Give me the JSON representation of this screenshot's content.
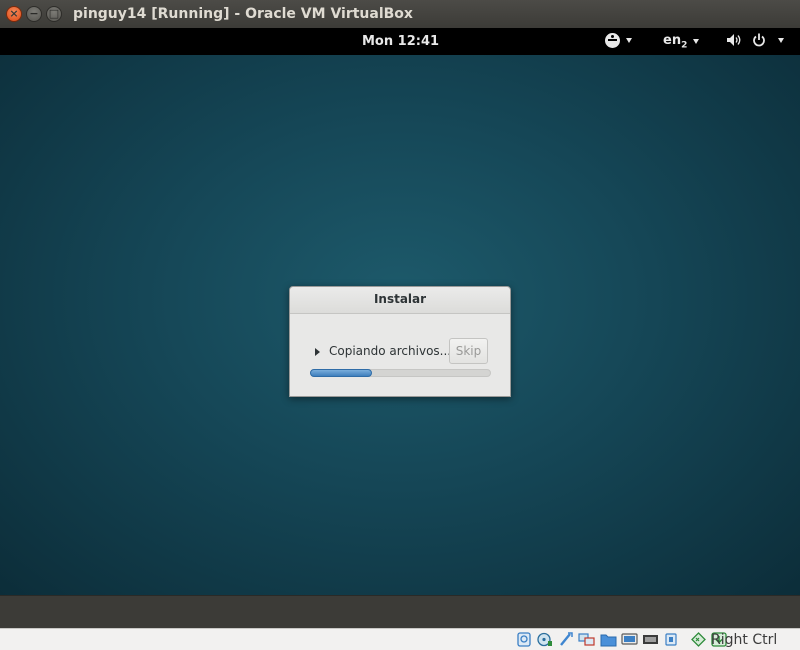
{
  "window": {
    "title": "pinguy14 [Running] - Oracle VM VirtualBox",
    "close_glyph": "×",
    "minimize_glyph": "−",
    "maximize_glyph": "□"
  },
  "guest_panel": {
    "clock": "Mon 12:41",
    "language": "en",
    "language_sub": "2",
    "icons": [
      "accessibility-icon",
      "volume-icon",
      "power-icon"
    ]
  },
  "dialog": {
    "title": "Instalar",
    "status": "Copiando archivos...",
    "skip_label": "Skip",
    "progress": 0.34
  },
  "statusbar": {
    "icons": [
      {
        "name": "hard-disk-icon",
        "color": "#3b7fc4"
      },
      {
        "name": "optical-drive-icon",
        "color": "#2a6e9c"
      },
      {
        "name": "usb-icon",
        "color": "#3f86d0"
      },
      {
        "name": "network-icon",
        "color": "#3b7fc4"
      },
      {
        "name": "shared-folders-icon",
        "color": "#3f86d0"
      },
      {
        "name": "display-icon",
        "color": "#5a5a5a"
      },
      {
        "name": "video-capture-icon",
        "color": "#3b3b3b"
      },
      {
        "name": "cpu-icon",
        "color": "#3b7fc4"
      },
      {
        "name": "mouse-integration-icon",
        "color": "#2e8b3a"
      },
      {
        "name": "keyboard-capture-icon",
        "color": "#2e8b3a"
      }
    ],
    "host_key": "Right Ctrl"
  }
}
